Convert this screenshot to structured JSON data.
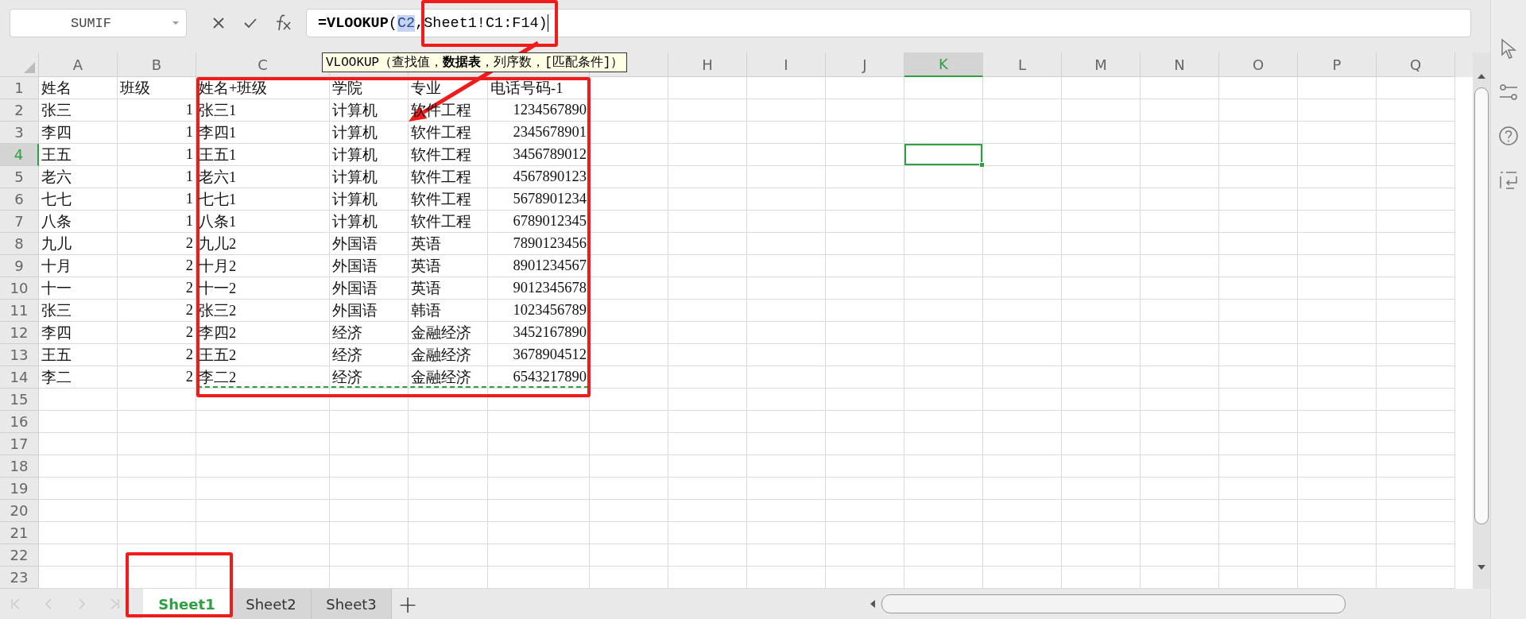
{
  "name_box": {
    "value": "SUMIF"
  },
  "formula": {
    "parts": [
      {
        "kind": "function",
        "text": "=VLOOKUP"
      },
      {
        "kind": "text",
        "text": "("
      },
      {
        "kind": "reference",
        "text": "C2"
      },
      {
        "kind": "text",
        "text": ",Sheet1!C1:F14)"
      }
    ]
  },
  "tooltip": {
    "text": "VLOOKUP（查找值，**数据表**，列序数，[匹配条件]）"
  },
  "columns": [
    {
      "label": "A",
      "selected": false
    },
    {
      "label": "B",
      "selected": false
    },
    {
      "label": "C",
      "selected": false
    },
    {
      "selected": false
    },
    {
      "selected": false
    },
    {
      "selected": false
    },
    {
      "selected": false
    },
    {
      "label": "H",
      "selected": false
    },
    {
      "label": "I",
      "selected": false
    },
    {
      "label": "J",
      "selected": false
    },
    {
      "label": "K",
      "selected": true
    },
    {
      "label": "L",
      "selected": false
    },
    {
      "label": "M",
      "selected": false
    },
    {
      "label": "N",
      "selected": false
    },
    {
      "label": "O",
      "selected": false
    },
    {
      "label": "P",
      "selected": false
    },
    {
      "label": "Q",
      "selected": false
    }
  ],
  "rows": [
    {
      "number": "1",
      "selected": false,
      "cells": [
        {
          "text": "姓名"
        },
        {
          "text": "班级"
        },
        {
          "text": "姓名+班级"
        },
        {
          "text": "学院"
        },
        {
          "text": "专业"
        },
        {
          "text": "电话号码-1"
        }
      ]
    },
    {
      "number": "2",
      "selected": false,
      "cells": [
        {
          "text": "张三"
        },
        {
          "text": "1",
          "kind": "number"
        },
        {
          "text": "张三1"
        },
        {
          "text": "计算机"
        },
        {
          "text": "软件工程"
        },
        {
          "text": "1234567890",
          "kind": "number"
        }
      ]
    },
    {
      "number": "3",
      "selected": false,
      "cells": [
        {
          "text": "李四"
        },
        {
          "text": "1",
          "kind": "number"
        },
        {
          "text": "李四1"
        },
        {
          "text": "计算机"
        },
        {
          "text": "软件工程"
        },
        {
          "text": "2345678901",
          "kind": "number"
        }
      ]
    },
    {
      "number": "4",
      "selected": true,
      "cells": [
        {
          "text": "王五"
        },
        {
          "text": "1",
          "kind": "number"
        },
        {
          "text": "王五1"
        },
        {
          "text": "计算机"
        },
        {
          "text": "软件工程"
        },
        {
          "text": "3456789012",
          "kind": "number"
        }
      ]
    },
    {
      "number": "5",
      "selected": false,
      "cells": [
        {
          "text": "老六"
        },
        {
          "text": "1",
          "kind": "number"
        },
        {
          "text": "老六1"
        },
        {
          "text": "计算机"
        },
        {
          "text": "软件工程"
        },
        {
          "text": "4567890123",
          "kind": "number"
        }
      ]
    },
    {
      "number": "6",
      "selected": false,
      "cells": [
        {
          "text": "七七"
        },
        {
          "text": "1",
          "kind": "number"
        },
        {
          "text": "七七1"
        },
        {
          "text": "计算机"
        },
        {
          "text": "软件工程"
        },
        {
          "text": "5678901234",
          "kind": "number"
        }
      ]
    },
    {
      "number": "7",
      "selected": false,
      "cells": [
        {
          "text": "八条"
        },
        {
          "text": "1",
          "kind": "number"
        },
        {
          "text": "八条1"
        },
        {
          "text": "计算机"
        },
        {
          "text": "软件工程"
        },
        {
          "text": "6789012345",
          "kind": "number"
        }
      ]
    },
    {
      "number": "8",
      "selected": false,
      "cells": [
        {
          "text": "九儿"
        },
        {
          "text": "2",
          "kind": "number"
        },
        {
          "text": "九儿2"
        },
        {
          "text": "外国语"
        },
        {
          "text": "英语"
        },
        {
          "text": "7890123456",
          "kind": "number"
        }
      ]
    },
    {
      "number": "9",
      "selected": false,
      "cells": [
        {
          "text": "十月"
        },
        {
          "text": "2",
          "kind": "number"
        },
        {
          "text": "十月2"
        },
        {
          "text": "外国语"
        },
        {
          "text": "英语"
        },
        {
          "text": "8901234567",
          "kind": "number"
        }
      ]
    },
    {
      "number": "10",
      "selected": false,
      "cells": [
        {
          "text": "十一"
        },
        {
          "text": "2",
          "kind": "number"
        },
        {
          "text": "十一2"
        },
        {
          "text": "外国语"
        },
        {
          "text": "英语"
        },
        {
          "text": "9012345678",
          "kind": "number"
        }
      ]
    },
    {
      "number": "11",
      "selected": false,
      "cells": [
        {
          "text": "张三"
        },
        {
          "text": "2",
          "kind": "number"
        },
        {
          "text": "张三2"
        },
        {
          "text": "外国语"
        },
        {
          "text": "韩语"
        },
        {
          "text": "1023456789",
          "kind": "number"
        }
      ]
    },
    {
      "number": "12",
      "selected": false,
      "cells": [
        {
          "text": "李四"
        },
        {
          "text": "2",
          "kind": "number"
        },
        {
          "text": "李四2"
        },
        {
          "text": "经济"
        },
        {
          "text": "金融经济"
        },
        {
          "text": "3452167890",
          "kind": "number"
        }
      ]
    },
    {
      "number": "13",
      "selected": false,
      "cells": [
        {
          "text": "王五"
        },
        {
          "text": "2",
          "kind": "number"
        },
        {
          "text": "王五2"
        },
        {
          "text": "经济"
        },
        {
          "text": "金融经济"
        },
        {
          "text": "3678904512",
          "kind": "number"
        }
      ]
    },
    {
      "number": "14",
      "selected": false,
      "cells": [
        {
          "text": "李二"
        },
        {
          "text": "2",
          "kind": "number"
        },
        {
          "text": "李二2"
        },
        {
          "text": "经济"
        },
        {
          "text": "金融经济"
        },
        {
          "text": "6543217890",
          "kind": "number"
        }
      ]
    },
    {
      "number": "15",
      "selected": false
    },
    {
      "number": "16",
      "selected": false
    },
    {
      "number": "17",
      "selected": false
    },
    {
      "number": "18",
      "selected": false
    },
    {
      "number": "19",
      "selected": false
    },
    {
      "number": "20",
      "selected": false
    },
    {
      "number": "21",
      "selected": false
    },
    {
      "number": "22",
      "selected": false
    },
    {
      "number": "23",
      "selected": false
    }
  ],
  "sheet_tabs": [
    {
      "label": "Sheet1",
      "selected": true
    },
    {
      "label": "Sheet2",
      "selected": false
    },
    {
      "label": "Sheet3",
      "selected": false
    }
  ],
  "add_sheet": {
    "label": "+"
  }
}
